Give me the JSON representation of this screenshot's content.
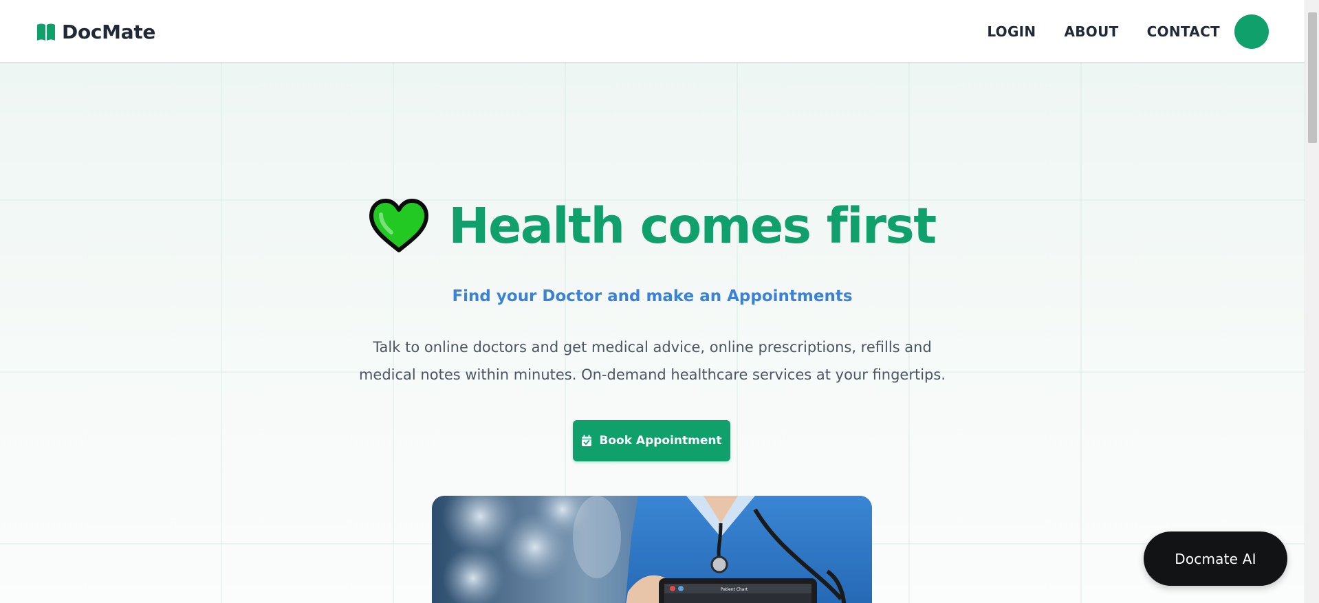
{
  "brand": {
    "name": "DocMate",
    "icon": "book-icon"
  },
  "nav": {
    "links": [
      {
        "label": "LOGIN"
      },
      {
        "label": "ABOUT"
      },
      {
        "label": "CONTACT"
      }
    ],
    "avatar_color": "#10a06b"
  },
  "hero": {
    "title": "Health comes first",
    "title_icon": "green-heart-icon",
    "subtitle": "Find your Doctor and make an Appointments",
    "description_line1": "Talk to online doctors and get medical advice, online prescriptions, refills and",
    "description_line2": "medical notes within minutes. On-demand healthcare services at your fingertips.",
    "cta_label": "Book Appointment",
    "cta_icon": "calendar-check-icon",
    "image_caption": "Patient Chart"
  },
  "chat_widget": {
    "label": "Docmate AI"
  },
  "colors": {
    "accent": "#10a06b",
    "subtitle": "#3b82d6",
    "text": "#1f2937",
    "chat_bg": "#111315"
  }
}
